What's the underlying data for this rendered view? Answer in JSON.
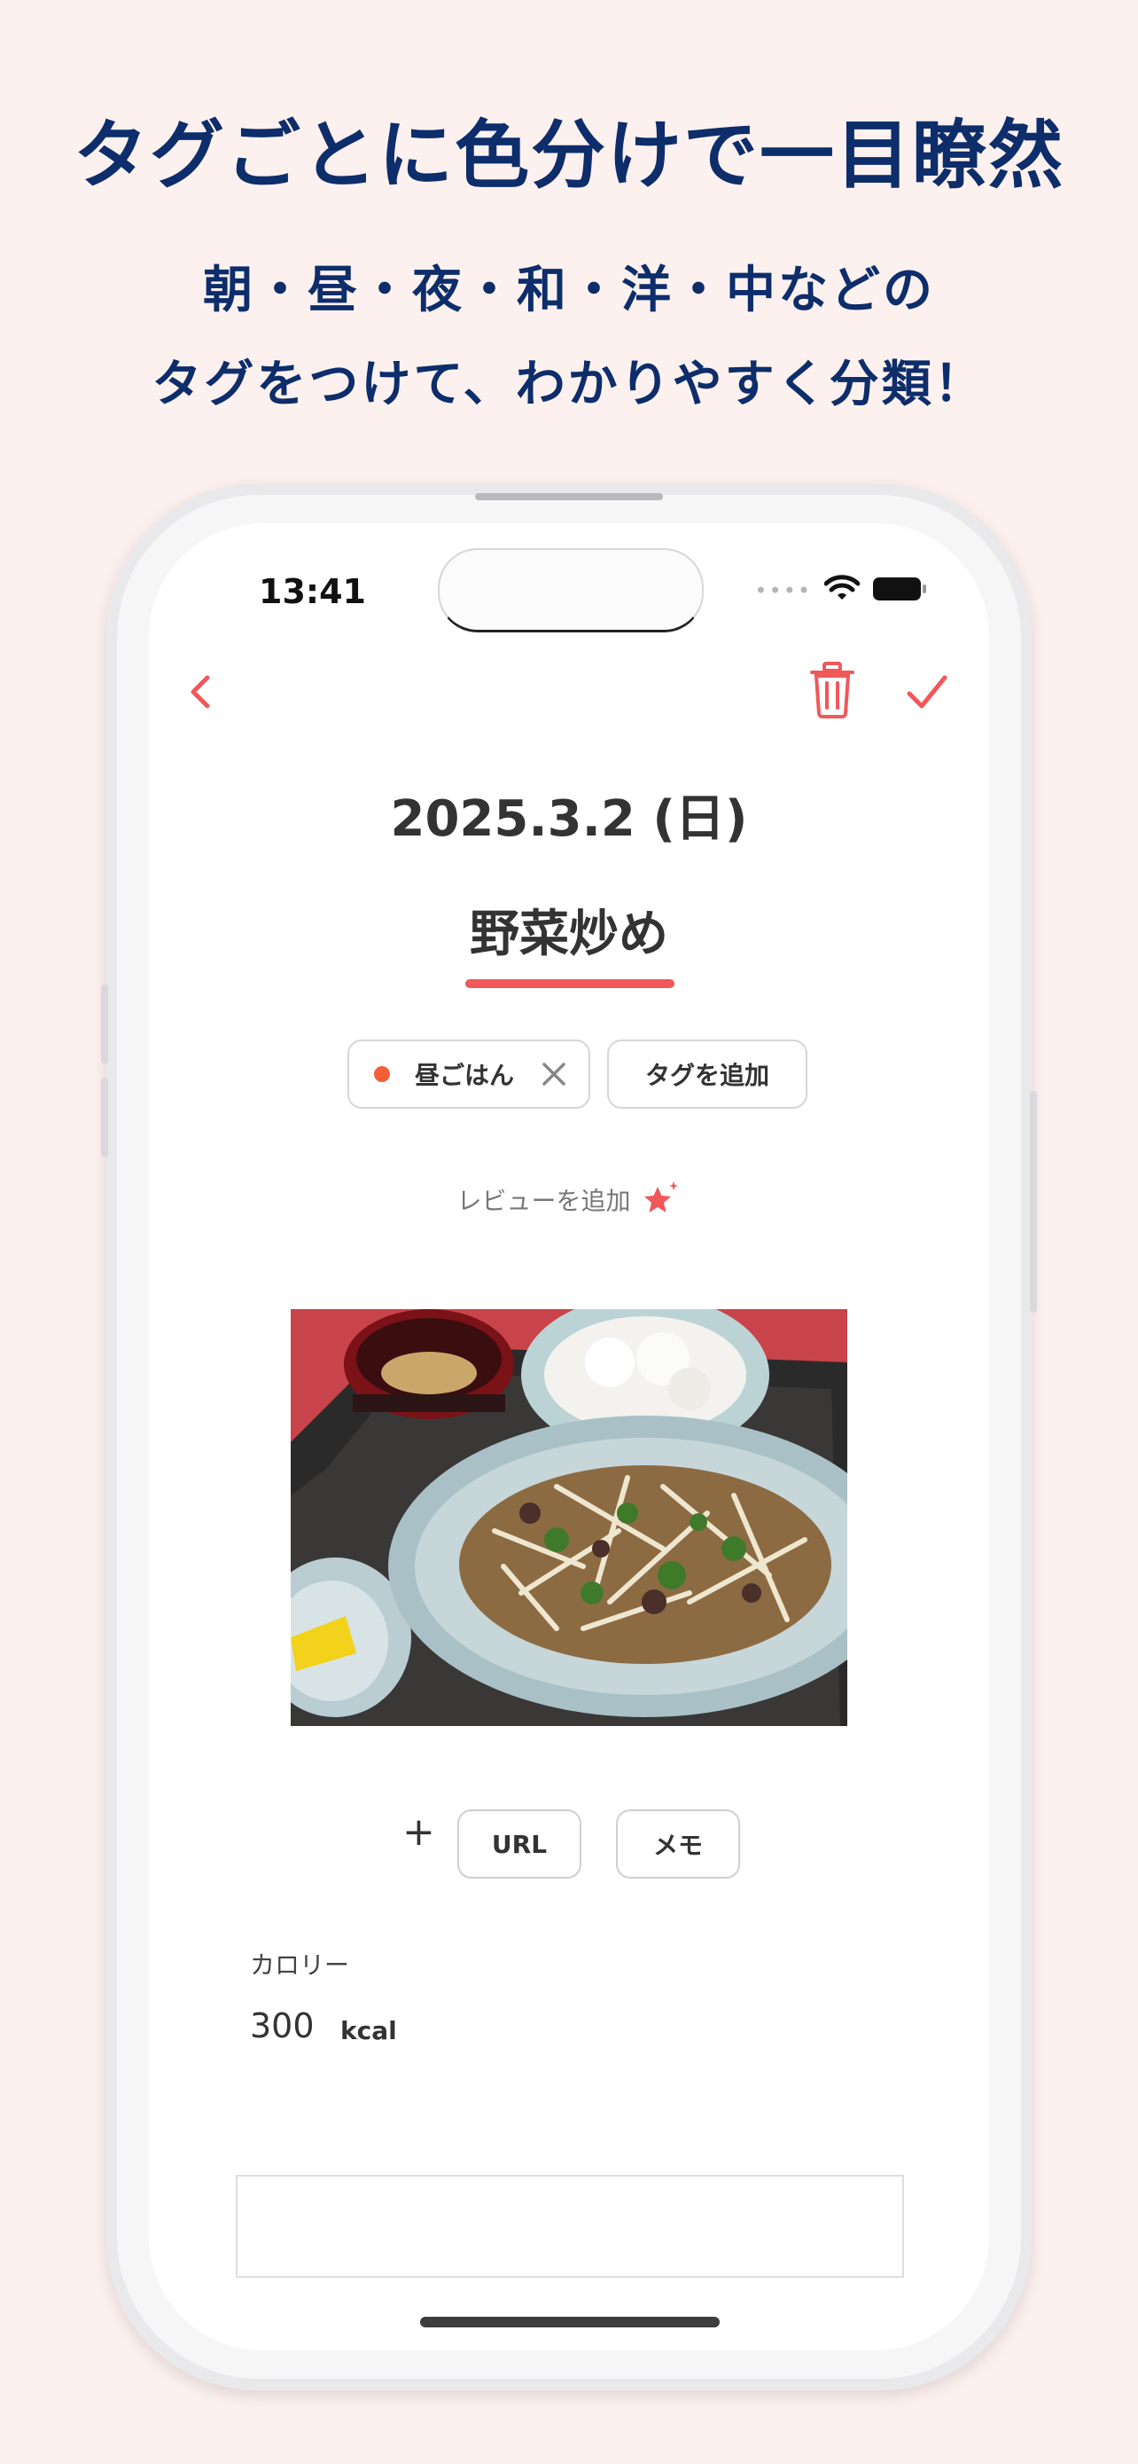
{
  "promo": {
    "headline": "タグごとに色分けで一目瞭然",
    "subline1": "朝・昼・夜・和・洋・中などの",
    "subline2": "タグをつけて、わかりやすく分類！"
  },
  "status_bar": {
    "time": "13:41",
    "signal_dots": "••••"
  },
  "entry": {
    "date": "2025.3.2 (日)",
    "dish_name": "野菜炒め",
    "tags": [
      {
        "label": "昼ごはん",
        "color": "#f45e36"
      }
    ],
    "add_tag_label": "タグを追加",
    "review_label": "レビューを追加"
  },
  "attachments": {
    "plus": "+",
    "url_label": "URL",
    "memo_label": "メモ"
  },
  "calorie": {
    "label": "カロリー",
    "value": "300",
    "unit": "kcal"
  },
  "colors": {
    "brand_text": "#0d2d6b",
    "accent_red": "#f0585a",
    "background": "#fdf1ef"
  },
  "icons": [
    "back-chevron-icon",
    "trash-icon",
    "checkmark-icon",
    "close-icon",
    "star-sparkle-icon",
    "wifi-icon",
    "battery-icon"
  ]
}
